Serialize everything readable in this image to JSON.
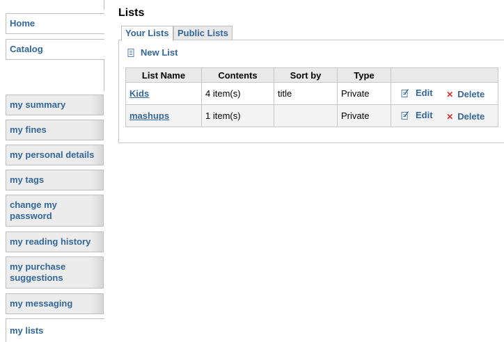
{
  "sidebar": {
    "items": [
      {
        "label": "Home"
      },
      {
        "label": "Catalog"
      },
      {
        "label": "my summary"
      },
      {
        "label": "my fines"
      },
      {
        "label": "my personal details"
      },
      {
        "label": "my tags"
      },
      {
        "label": "change my password"
      },
      {
        "label": "my reading history"
      },
      {
        "label": "my purchase suggestions"
      },
      {
        "label": "my messaging"
      },
      {
        "label": "my lists"
      }
    ]
  },
  "page": {
    "title": "Lists"
  },
  "tabs": [
    {
      "label": "Your Lists",
      "active": true
    },
    {
      "label": "Public Lists",
      "active": false
    }
  ],
  "new_list": {
    "label": "New List",
    "icon": "new-list-icon"
  },
  "table": {
    "headers": [
      "List Name",
      "Contents",
      "Sort by",
      "Type",
      ""
    ],
    "rows": [
      {
        "name": "Kids",
        "contents": "4 item(s)",
        "sort_by": "title",
        "type": "Private",
        "edit": "Edit",
        "delete": "Delete"
      },
      {
        "name": "mashups",
        "contents": "1 item(s)",
        "sort_by": "",
        "type": "Private",
        "edit": "Edit",
        "delete": "Delete"
      }
    ]
  },
  "colors": {
    "link": "#336699",
    "delete_icon": "#cc3333",
    "header_bg": "#e9e9e9"
  }
}
